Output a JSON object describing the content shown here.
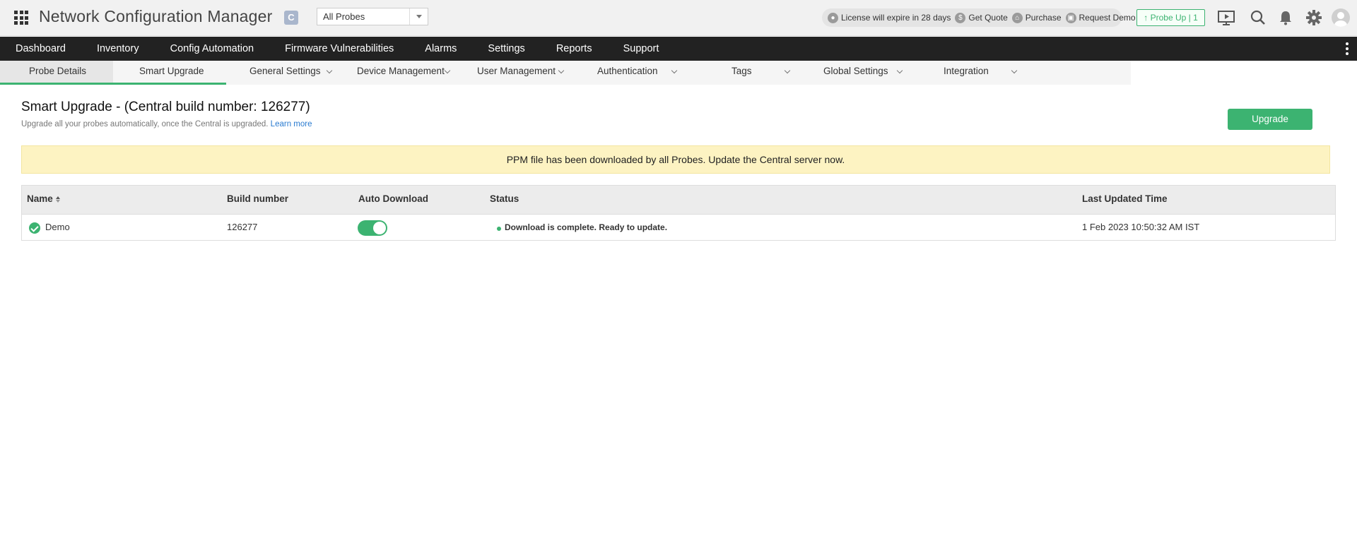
{
  "header": {
    "app_title": "Network Configuration Manager",
    "badge": "C",
    "probe_select_value": "All Probes",
    "license_text": "License will expire in 28 days",
    "get_quote": "Get Quote",
    "purchase": "Purchase",
    "request_demo": "Request Demo",
    "probe_up": "Probe Up | 1",
    "icons": [
      "apps-icon",
      "presenter-icon",
      "search-icon",
      "bell-icon",
      "gear-icon",
      "avatar"
    ]
  },
  "mainnav": {
    "items": [
      "Dashboard",
      "Inventory",
      "Config Automation",
      "Firmware Vulnerabilities",
      "Alarms",
      "Settings",
      "Reports",
      "Support"
    ]
  },
  "subtabs": {
    "items": [
      "Probe Details",
      "Smart Upgrade",
      "General Settings",
      "Device Management",
      "User Management",
      "Authentication",
      "Tags",
      "Global Settings",
      "Integration"
    ]
  },
  "page": {
    "title": "Smart Upgrade - (Central build number: 126277)",
    "subtitle": "Upgrade all your probes automatically, once the Central is upgraded.",
    "learn_more": "Learn more",
    "upgrade_button": "Upgrade",
    "notice": "PPM file has been downloaded by all Probes. Update the Central server now."
  },
  "table": {
    "columns": [
      "Name",
      "Build number",
      "Auto Download",
      "Status",
      "Last Updated Time"
    ],
    "rows": [
      {
        "name": "Demo",
        "build": "126277",
        "auto_download": true,
        "status": "Download is complete. Ready to update.",
        "last_updated": "1 Feb 2023 10:50:32 AM IST"
      }
    ]
  },
  "colors": {
    "accent": "#3cb371",
    "nav_bg": "#222222",
    "notice_bg": "#fdf3c2"
  }
}
